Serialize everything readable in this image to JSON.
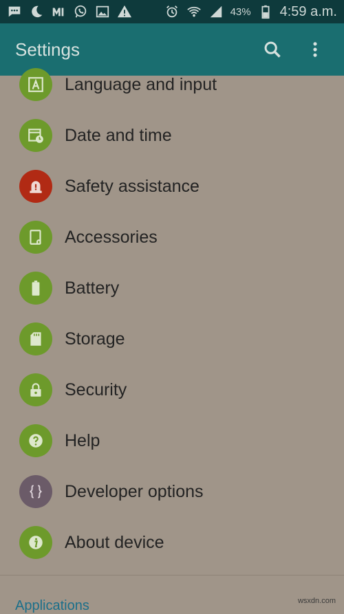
{
  "status_bar": {
    "battery_percent": "43%",
    "time": "4:59 a.m.",
    "left_icons": [
      "chat-icon",
      "moon-icon",
      "m-app-icon",
      "whatsapp-icon",
      "gallery-icon",
      "warning-icon"
    ],
    "right_icons": [
      "alarm-icon",
      "wifi-icon",
      "signal-icon",
      "battery-icon"
    ]
  },
  "app_bar": {
    "title": "Settings",
    "actions": [
      "search-icon",
      "more-vert-icon"
    ]
  },
  "settings_items": [
    {
      "label": "Language and input",
      "icon": "language-icon",
      "color": "#6d9a2b"
    },
    {
      "label": "Date and time",
      "icon": "calendar-clock-icon",
      "color": "#6d9a2b"
    },
    {
      "label": "Safety assistance",
      "icon": "alert-siren-icon",
      "color": "#b12a14"
    },
    {
      "label": "Accessories",
      "icon": "accessories-icon",
      "color": "#6d9a2b"
    },
    {
      "label": "Battery",
      "icon": "battery-icon",
      "color": "#6d9a2b"
    },
    {
      "label": "Storage",
      "icon": "sd-card-icon",
      "color": "#6d9a2b"
    },
    {
      "label": "Security",
      "icon": "lock-icon",
      "color": "#6d9a2b"
    },
    {
      "label": "Help",
      "icon": "help-icon",
      "color": "#6d9a2b"
    },
    {
      "label": "Developer options",
      "icon": "braces-icon",
      "color": "#6b5b68"
    },
    {
      "label": "About device",
      "icon": "info-icon",
      "color": "#6d9a2b"
    }
  ],
  "next_section": {
    "title": "Applications"
  },
  "watermark": "wsxdn.com"
}
